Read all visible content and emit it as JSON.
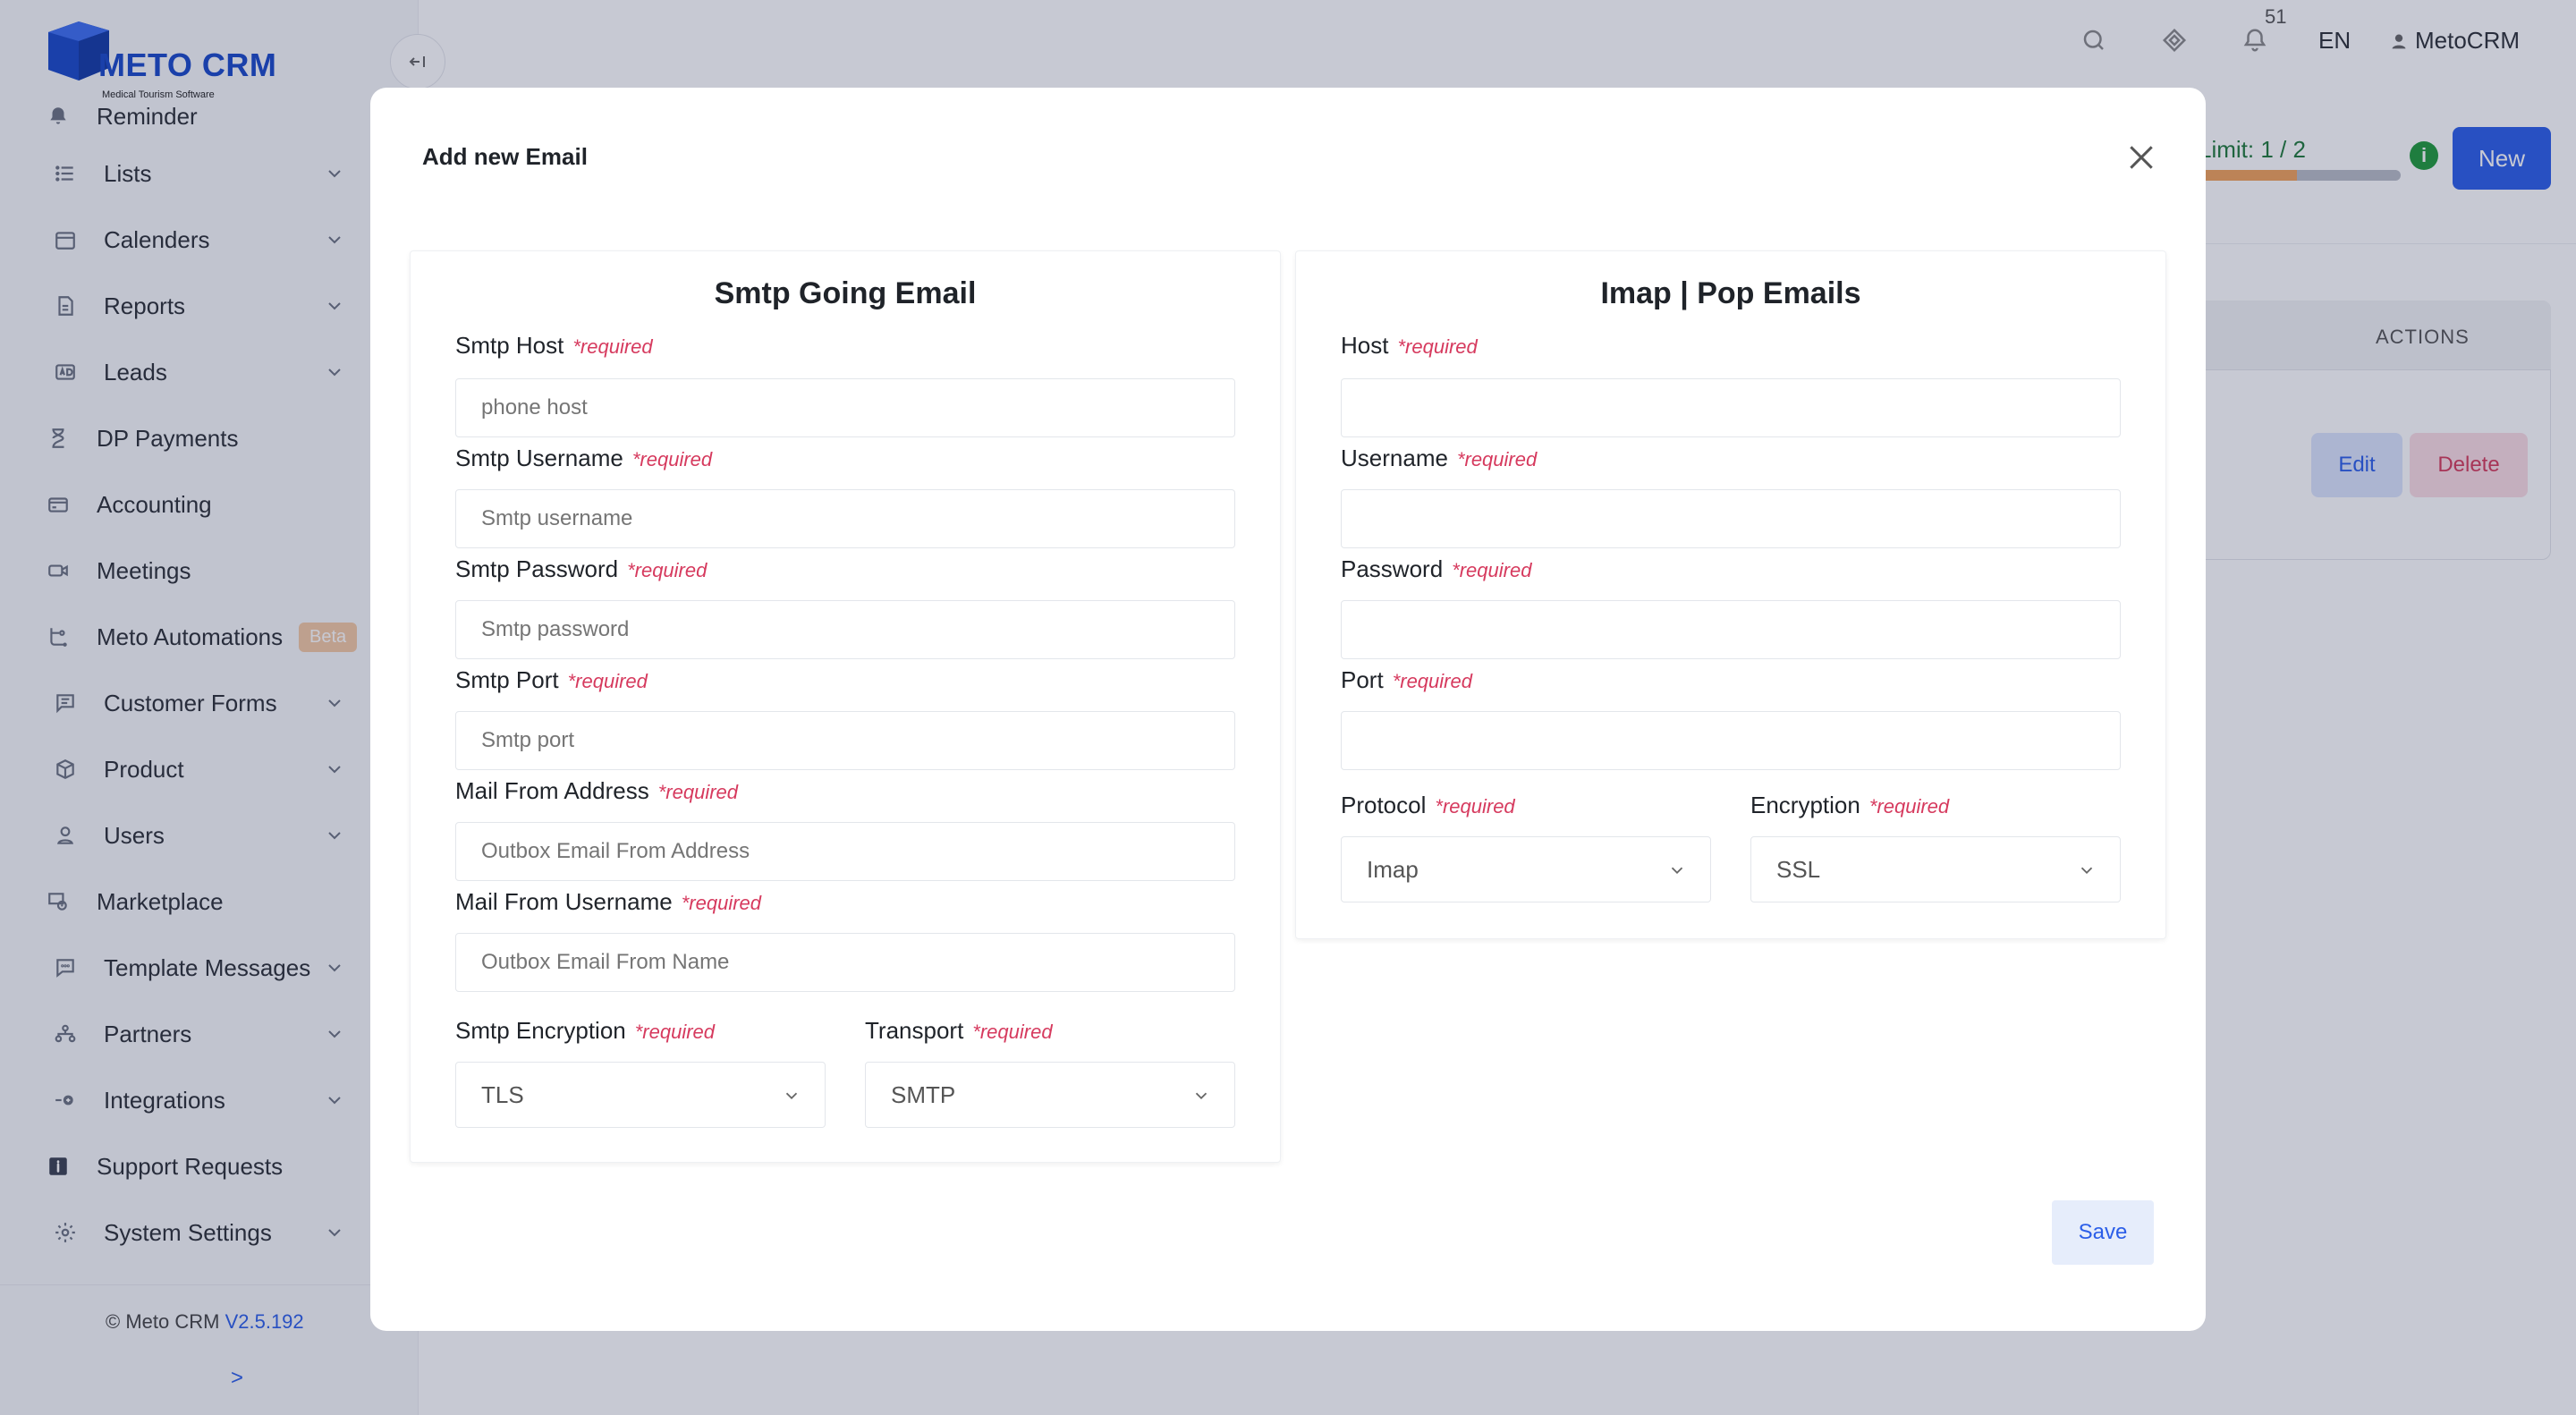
{
  "brand": {
    "title": "METO CRM",
    "subtitle": "Medical Tourism Software"
  },
  "sidebar": {
    "items": [
      {
        "label": "Reminder",
        "icon": "bell-icon",
        "chevron": false
      },
      {
        "label": "Lists",
        "icon": "list-icon",
        "chevron": true
      },
      {
        "label": "Calenders",
        "icon": "calendar-icon",
        "chevron": true
      },
      {
        "label": "Reports",
        "icon": "report-icon",
        "chevron": true
      },
      {
        "label": "Leads",
        "icon": "ad-icon",
        "chevron": true
      },
      {
        "label": "DP Payments",
        "icon": "hourglass-icon",
        "chevron": false
      },
      {
        "label": "Accounting",
        "icon": "credit-card-icon",
        "chevron": false
      },
      {
        "label": "Meetings",
        "icon": "video-icon",
        "chevron": false
      },
      {
        "label": "Meto Automations",
        "icon": "automation-icon",
        "chevron": false,
        "badge": "Beta"
      },
      {
        "label": "Customer Forms",
        "icon": "form-icon",
        "chevron": true
      },
      {
        "label": "Product",
        "icon": "box-icon",
        "chevron": true
      },
      {
        "label": "Users",
        "icon": "user-icon",
        "chevron": true
      },
      {
        "label": "Marketplace",
        "icon": "marketplace-icon",
        "chevron": false
      },
      {
        "label": "Template Messages",
        "icon": "message-icon",
        "chevron": true
      },
      {
        "label": "Partners",
        "icon": "partners-icon",
        "chevron": true
      },
      {
        "label": "Integrations",
        "icon": "plug-icon",
        "chevron": true
      },
      {
        "label": "Support Requests",
        "icon": "info-icon",
        "chevron": false
      },
      {
        "label": "System Settings",
        "icon": "gear-icon",
        "chevron": true
      }
    ],
    "footer": {
      "copyright": "© Meto CRM",
      "version": "V2.5.192",
      "expand": ">"
    }
  },
  "topbar": {
    "notification_count": "51",
    "language": "EN",
    "user": "MetoCRM"
  },
  "main": {
    "limit_text": "Limit: 1 / 2",
    "limit_fraction": 0.5,
    "new_button": "New",
    "table_actions_header": "ACTIONS",
    "edit_button": "Edit",
    "delete_button": "Delete"
  },
  "modal": {
    "title": "Add new Email",
    "required_label": "*required",
    "smtp": {
      "title": "Smtp Going Email",
      "host_label": "Smtp Host",
      "host_placeholder": "phone host",
      "username_label": "Smtp Username",
      "username_placeholder": "Smtp username",
      "password_label": "Smtp Password",
      "password_placeholder": "Smtp password",
      "port_label": "Smtp Port",
      "port_placeholder": "Smtp port",
      "from_address_label": "Mail From Address",
      "from_address_placeholder": "Outbox Email From Address",
      "from_username_label": "Mail From Username",
      "from_username_placeholder": "Outbox Email From Name",
      "encryption_label": "Smtp Encryption",
      "encryption_value": "TLS",
      "transport_label": "Transport",
      "transport_value": "SMTP"
    },
    "imap": {
      "title": "Imap | Pop Emails",
      "host_label": "Host",
      "username_label": "Username",
      "password_label": "Password",
      "port_label": "Port",
      "protocol_label": "Protocol",
      "protocol_value": "Imap",
      "encryption_label": "Encryption",
      "encryption_value": "SSL"
    },
    "save_button": "Save"
  },
  "colors": {
    "accent": "#2b5ee8",
    "required": "#d63a5e",
    "success": "#1f9a3a",
    "danger": "#d43a5a"
  }
}
